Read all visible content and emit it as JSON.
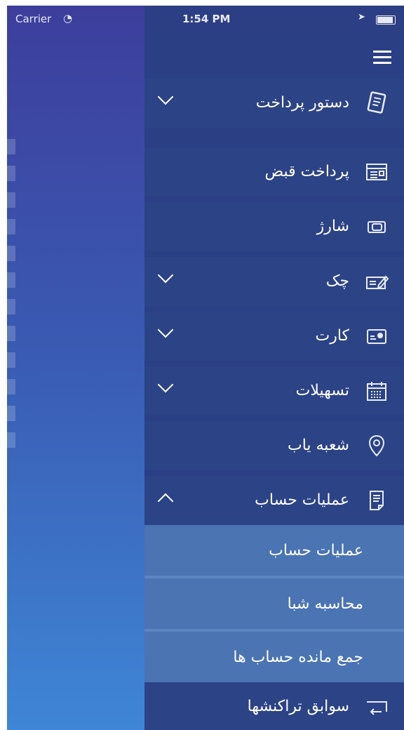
{
  "status_bar": {
    "carrier": "Carrier",
    "time": "1:54 PM"
  },
  "menu": {
    "items": [
      {
        "label": "دستور پرداخت",
        "icon": "payment-order-icon",
        "expandable": true,
        "expanded": false
      },
      {
        "label": "پرداخت قبض",
        "icon": "bill-icon",
        "expandable": false
      },
      {
        "label": "شارژ",
        "icon": "charge-card-icon",
        "expandable": false
      },
      {
        "label": "چک",
        "icon": "cheque-icon",
        "expandable": true,
        "expanded": false
      },
      {
        "label": "کارت",
        "icon": "card-icon",
        "expandable": true,
        "expanded": false
      },
      {
        "label": "تسهیلات",
        "icon": "calendar-icon",
        "expandable": true,
        "expanded": false
      },
      {
        "label": "شعبه یاب",
        "icon": "location-pin-icon",
        "expandable": false
      },
      {
        "label": "عملیات حساب",
        "icon": "document-icon",
        "expandable": true,
        "expanded": true
      }
    ],
    "subitems": [
      {
        "label": "عملیات حساب"
      },
      {
        "label": "محاسبه شبا"
      },
      {
        "label": "جمع مانده حساب ها"
      }
    ],
    "last_item": {
      "label": "سوابق تراکنشها",
      "icon": "return-arrow-icon"
    }
  },
  "colors": {
    "panel": "#2b3f85",
    "row": "#2c4385",
    "subrow": "#4a74b2",
    "accent": "#ffffff"
  }
}
